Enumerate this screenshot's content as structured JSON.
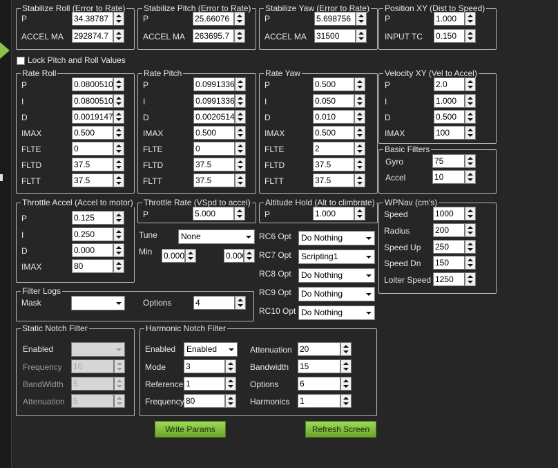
{
  "lock_pitch_roll": {
    "label": "Lock Pitch and Roll Values",
    "checked": false
  },
  "stab_roll": {
    "title": "Stabilize Roll (Error to Rate)",
    "p_label": "P",
    "p_value": "34.38787",
    "accel_label": "ACCEL MA",
    "accel_value": "292874.7"
  },
  "stab_pitch": {
    "title": "Stabilize Pitch (Error to Rate)",
    "p_label": "P",
    "p_value": "25.66076",
    "accel_label": "ACCEL MA",
    "accel_value": "263695.7"
  },
  "stab_yaw": {
    "title": "Stabilize Yaw (Error to Rate)",
    "p_label": "P",
    "p_value": "5.698756",
    "accel_label": "ACCEL MA",
    "accel_value": "31500"
  },
  "pos_xy": {
    "title": "Position XY (Dist to Speed)",
    "p_label": "P",
    "p_value": "1.000",
    "tc_label": "INPUT TC",
    "tc_value": "0.150"
  },
  "rate_roll": {
    "title": "Rate Roll",
    "rows": [
      {
        "label": "P",
        "value": "0.08005102"
      },
      {
        "label": "I",
        "value": "0.08005102"
      },
      {
        "label": "D",
        "value": "0.001914714"
      },
      {
        "label": "IMAX",
        "value": "0.500"
      },
      {
        "label": "FLTE",
        "value": "0"
      },
      {
        "label": "FLTD",
        "value": "37.5"
      },
      {
        "label": "FLTT",
        "value": "37.5"
      }
    ]
  },
  "rate_pitch": {
    "title": "Rate Pitch",
    "rows": [
      {
        "label": "P",
        "value": "0.09913362"
      },
      {
        "label": "I",
        "value": "0.09913362"
      },
      {
        "label": "D",
        "value": "0.002051417"
      },
      {
        "label": "IMAX",
        "value": "0.500"
      },
      {
        "label": "FLTE",
        "value": "0"
      },
      {
        "label": "FLTD",
        "value": "37.5"
      },
      {
        "label": "FLTT",
        "value": "37.5"
      }
    ]
  },
  "rate_yaw": {
    "title": "Rate Yaw",
    "rows": [
      {
        "label": "P",
        "value": "0.500"
      },
      {
        "label": "I",
        "value": "0.050"
      },
      {
        "label": "D",
        "value": "0.010"
      },
      {
        "label": "IMAX",
        "value": "0.500"
      },
      {
        "label": "FLTE",
        "value": "2"
      },
      {
        "label": "FLTD",
        "value": "37.5"
      },
      {
        "label": "FLTT",
        "value": "37.5"
      }
    ]
  },
  "vel_xy": {
    "title": "Velocity XY (Vel to Accel)",
    "rows": [
      {
        "label": "P",
        "value": "2.0"
      },
      {
        "label": "I",
        "value": "1.000"
      },
      {
        "label": "D",
        "value": "0.500"
      },
      {
        "label": "IMAX",
        "value": "100"
      }
    ]
  },
  "basic_filters": {
    "title": "Basic Filters",
    "rows": [
      {
        "label": "Gyro",
        "value": "75"
      },
      {
        "label": "Accel",
        "value": "10"
      }
    ]
  },
  "throttle_accel": {
    "title": "Throttle Accel (Accel to motor)",
    "rows": [
      {
        "label": "P",
        "value": "0.125"
      },
      {
        "label": "I",
        "value": "0.250"
      },
      {
        "label": "D",
        "value": "0.000"
      },
      {
        "label": "IMAX",
        "value": "80"
      }
    ]
  },
  "throttle_rate": {
    "title": "Throttle Rate (VSpd to accel)",
    "p_label": "P",
    "p_value": "5.000"
  },
  "alt_hold": {
    "title": "Altitude Hold (Alt to climbrate)",
    "p_label": "P",
    "p_value": "1.000"
  },
  "wpnav": {
    "title": "WPNav (cm's)",
    "rows": [
      {
        "label": "Speed",
        "value": "1000"
      },
      {
        "label": "Radius",
        "value": "200"
      },
      {
        "label": "Speed Up",
        "value": "250"
      },
      {
        "label": "Speed Dn",
        "value": "150"
      },
      {
        "label": "Loiter Speed",
        "value": "1250"
      }
    ]
  },
  "tune": {
    "label": "Tune",
    "value": "None",
    "min_label": "Min",
    "min_value": "0.000",
    "max_value": "0.000"
  },
  "rc_opts": [
    {
      "label": "RC6 Opt",
      "value": "Do Nothing"
    },
    {
      "label": "RC7 Opt",
      "value": "Scripting1"
    },
    {
      "label": "RC8 Opt",
      "value": "Do Nothing"
    },
    {
      "label": "RC9 Opt",
      "value": "Do Nothing"
    },
    {
      "label": "RC10 Opt",
      "value": "Do Nothing"
    }
  ],
  "filter_logs": {
    "title": "Filter Logs",
    "mask_label": "Mask",
    "mask_value": "",
    "options_label": "Options",
    "options_value": "4"
  },
  "static_notch": {
    "title": "Static Notch Filter",
    "enabled_label": "Enabled",
    "enabled_value": "",
    "freq_label": "Frequency",
    "freq_value": "10",
    "bw_label": "BandWidth",
    "bw_value": "5",
    "att_label": "Attenuation",
    "att_value": "5"
  },
  "harmonic_notch": {
    "title": "Harmonic Notch Filter",
    "enabled_label": "Enabled",
    "enabled_value": "Enabled",
    "mode_label": "Mode",
    "mode_value": "3",
    "ref_label": "Reference",
    "ref_value": "1",
    "freq_label": "Frequency",
    "freq_value": "80",
    "att_label": "Attenuation",
    "att_value": "20",
    "bw_label": "Bandwidth",
    "bw_value": "15",
    "opt_label": "Options",
    "opt_value": "6",
    "harm_label": "Harmonics",
    "harm_value": "1"
  },
  "buttons": {
    "write": "Write Params",
    "refresh": "Refresh Screen"
  }
}
